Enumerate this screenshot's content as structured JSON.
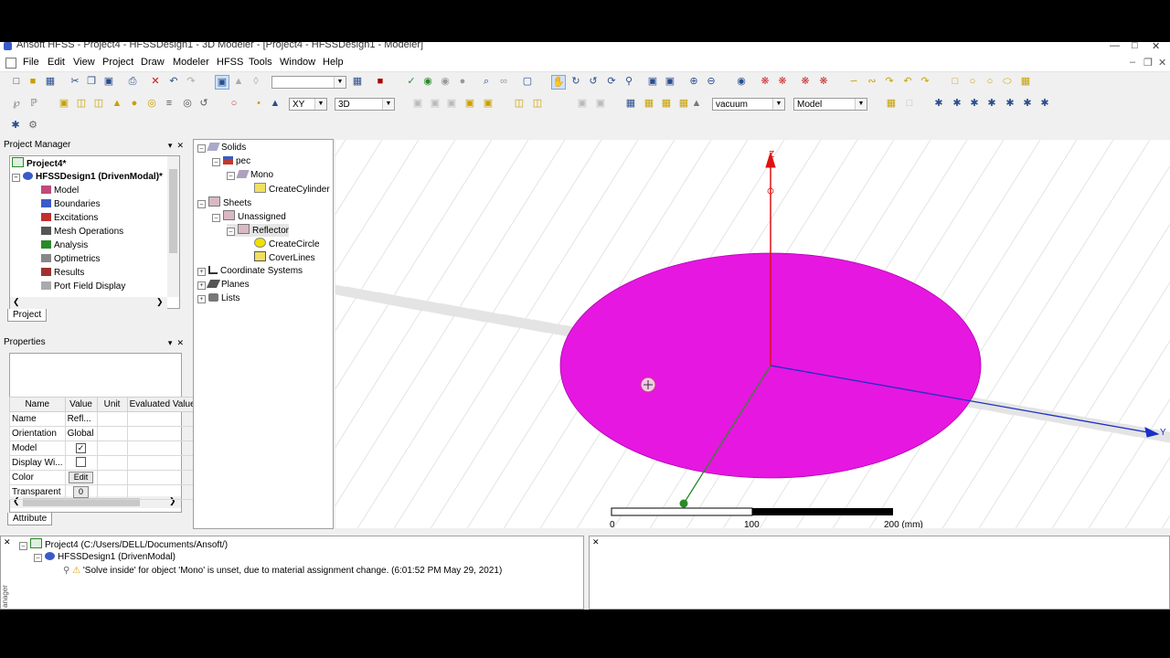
{
  "window": {
    "title": "Ansoft HFSS - Project4 - HFSSDesign1 - 3D Modeler - [Project4 - HFSSDesign1 - Modeler]"
  },
  "menu": [
    "File",
    "Edit",
    "View",
    "Project",
    "Draw",
    "Modeler",
    "HFSS",
    "Tools",
    "Window",
    "Help"
  ],
  "toolbar": {
    "plane": "XY",
    "mode": "3D",
    "material": "vacuum",
    "model": "Model",
    "empty_combo": ""
  },
  "project_manager": {
    "title": "Project Manager",
    "root": "Project4*",
    "design": "HFSSDesign1 (DrivenModal)*",
    "items": [
      "Model",
      "Boundaries",
      "Excitations",
      "Mesh Operations",
      "Analysis",
      "Optimetrics",
      "Results",
      "Port Field Display"
    ],
    "tab": "Project"
  },
  "properties": {
    "title": "Properties",
    "headers": [
      "Name",
      "Value",
      "Unit",
      "Evaluated Value"
    ],
    "rows": [
      {
        "name": "Name",
        "value": "Refl..."
      },
      {
        "name": "Orientation",
        "value": "Global"
      },
      {
        "name": "Model",
        "value": ""
      },
      {
        "name": "Display Wi...",
        "value": ""
      },
      {
        "name": "Color",
        "value": "Edit"
      },
      {
        "name": "Transparent",
        "value": "0"
      }
    ],
    "tab": "Attribute"
  },
  "model_tree": {
    "solids": "Solids",
    "pec": "pec",
    "mono": "Mono",
    "create_cylinder": "CreateCylinder",
    "sheets": "Sheets",
    "unassigned": "Unassigned",
    "reflector": "Reflector",
    "create_circle": "CreateCircle",
    "cover_lines": "CoverLines",
    "coord_systems": "Coordinate Systems",
    "planes": "Planes",
    "lists": "Lists"
  },
  "viewport": {
    "axis_z": "Z",
    "axis_y": "Y",
    "scale": [
      "0",
      "100",
      "200 (mm)"
    ],
    "colors": {
      "disc": "#e617e0",
      "z_axis": "#e01010",
      "y_axis": "#1a2fc8",
      "x_axis": "#2a8a2a"
    }
  },
  "messages": {
    "project": "Project4 (C:/Users/DELL/Documents/Ansoft/)",
    "design": "HFSSDesign1 (DrivenModal)",
    "warning": "'Solve inside' for object 'Mono' is unset, due to material assignment change. (6:01:52 PM  May 29, 2021)"
  }
}
